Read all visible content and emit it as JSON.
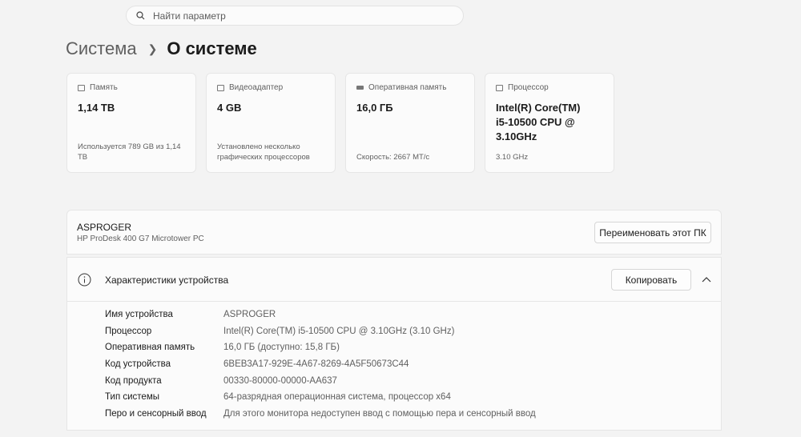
{
  "search": {
    "placeholder": "Найти параметр"
  },
  "breadcrumb": {
    "parent": "Система",
    "current": "О системе"
  },
  "cards": [
    {
      "icon": "storage-icon",
      "title": "Память",
      "value": "1,14 TB",
      "sub": "Используется 789 GB из 1,14 TB"
    },
    {
      "icon": "gpu-icon",
      "title": "Видеоадаптер",
      "value": "4 GB",
      "sub": "Установлено несколько графических процессоров"
    },
    {
      "icon": "ram-icon",
      "title": "Оперативная память",
      "value": "16,0 ГБ",
      "sub": "Скорость: 2667 MT/c"
    },
    {
      "icon": "cpu-icon",
      "title": "Процессор",
      "value": "Intel(R) Core(TM) i5-10500 CPU @ 3.10GHz",
      "sub": "3.10 GHz"
    }
  ],
  "device": {
    "name": "ASPROGER",
    "model": "HP ProDesk 400 G7 Microtower PC",
    "rename_label": "Переименовать этот ПК"
  },
  "specs": {
    "title": "Характеристики устройства",
    "copy_label": "Копировать",
    "rows": [
      {
        "k": "Имя устройства",
        "v": "ASPROGER"
      },
      {
        "k": "Процессор",
        "v": "Intel(R) Core(TM) i5-10500 CPU @ 3.10GHz (3.10 GHz)"
      },
      {
        "k": "Оперативная память",
        "v": "16,0 ГБ (доступно: 15,8 ГБ)"
      },
      {
        "k": "Код устройства",
        "v": "6BEB3A17-929E-4A67-8269-4A5F50673C44"
      },
      {
        "k": "Код продукта",
        "v": "00330-80000-00000-AA637"
      },
      {
        "k": "Тип системы",
        "v": "64-разрядная операционная система, процессор x64"
      },
      {
        "k": "Перо и сенсорный ввод",
        "v": "Для этого монитора недоступен ввод с помощью пера и сенсорный ввод"
      }
    ]
  }
}
